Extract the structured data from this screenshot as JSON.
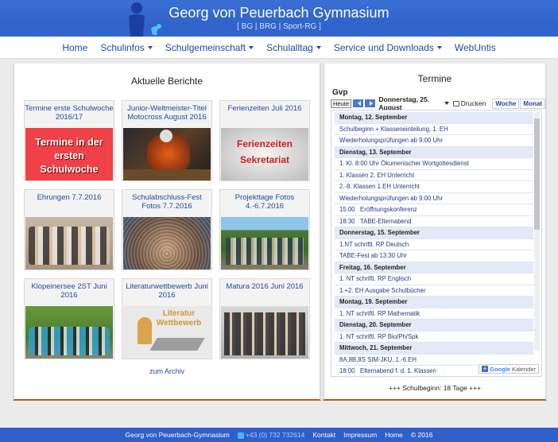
{
  "header": {
    "title": "Georg von Peuerbach Gymnasium",
    "subtitle": "[ BG | BRG | Sport-RG ]"
  },
  "nav": {
    "items": [
      {
        "label": "Home",
        "dropdown": false
      },
      {
        "label": "Schulinfos",
        "dropdown": true
      },
      {
        "label": "Schulgemeinschaft",
        "dropdown": true
      },
      {
        "label": "Schulalltag",
        "dropdown": true
      },
      {
        "label": "Service und Downloads",
        "dropdown": true
      },
      {
        "label": "WebUntis",
        "dropdown": false
      }
    ]
  },
  "reports": {
    "title": "Aktuelle Berichte",
    "cards": [
      {
        "title": "Termine erste Schulwoche 2016/17",
        "image_text": "Termine in der ersten Schulwoche"
      },
      {
        "title": "Junior-Weltmeister-Titel Motocross August 2016"
      },
      {
        "title": "Ferienzeiten Juli 2016",
        "image_text": "Ferienzeiten Sekretariat"
      },
      {
        "title": "Ehrungen 7.7.2016"
      },
      {
        "title": "Schulabschluss-Fest Fotos 7.7.2016"
      },
      {
        "title": "Projekttage Fotos 4.-6.7.2016"
      },
      {
        "title": "Klopeinersee 2ST Juni 2016"
      },
      {
        "title": "Literaturwettbewerb Juni 2016",
        "image_text": "Literatur Wettbewerb"
      },
      {
        "title": "Matura 2016 Juni 2016"
      }
    ],
    "archive_link": "zum Archiv"
  },
  "calendar": {
    "title": "Termine",
    "name": "Gvp",
    "today_button": "Heute",
    "date_label": "Donnerstag, 25. August",
    "print_label": "Drucken",
    "tabs": [
      "Woche",
      "Monat"
    ],
    "rows": [
      {
        "type": "day",
        "text": "Montag, 12. September"
      },
      {
        "type": "event",
        "time": "",
        "text": "Schulbeginn + Klasseneinteilung, 1. EH"
      },
      {
        "type": "event",
        "time": "",
        "text": "Wiederholungsprüfungen ab 9:00 Uhr"
      },
      {
        "type": "day",
        "text": "Dienstag, 13. September"
      },
      {
        "type": "event",
        "time": "",
        "text": "1. Kl. 8:00 Uhr Ökumenischer Wortgottesdienst"
      },
      {
        "type": "event",
        "time": "",
        "text": "1. Klassen 2. EH Unterricht"
      },
      {
        "type": "event",
        "time": "",
        "text": "2.-8. Klassen 1.EH Unterricht"
      },
      {
        "type": "event",
        "time": "",
        "text": "Wiederholungsprüfungen ab 9:00 Uhr"
      },
      {
        "type": "event",
        "time": "15:00",
        "text": "Eröffnungskonferenz"
      },
      {
        "type": "event",
        "time": "18:30",
        "text": "TABE-Elternabend"
      },
      {
        "type": "day",
        "text": "Donnerstag, 15. September"
      },
      {
        "type": "event",
        "time": "",
        "text": "1.NT schriftl. RP Deutsch"
      },
      {
        "type": "event",
        "time": "",
        "text": "TABE-Fest ab 13:30 Uhr"
      },
      {
        "type": "day",
        "text": "Freitag, 16. September"
      },
      {
        "type": "event",
        "time": "",
        "text": "1. NT schriftl. RP Englisch"
      },
      {
        "type": "event",
        "time": "",
        "text": "1.+2. EH Ausgabe Schulbücher"
      },
      {
        "type": "day",
        "text": "Montag, 19. September"
      },
      {
        "type": "event",
        "time": "",
        "text": "1. NT schriftl. RP Mathematik"
      },
      {
        "type": "day",
        "text": "Dienstag, 20. September"
      },
      {
        "type": "event",
        "time": "",
        "text": "1. NT schriftl. RP Bio/Ph/Spk"
      },
      {
        "type": "day",
        "text": "Mittwoch, 21. September"
      },
      {
        "type": "event",
        "time": "",
        "text": "8A,8B,8S SIM-JKU, 1.-6.EH"
      },
      {
        "type": "event",
        "time": "18:00",
        "text": "Elternabend f. d. 1. Klassen"
      }
    ],
    "gcal_google": "Google",
    "gcal_kalender": "Kalender",
    "countdown": "+++ Schulbeginn: 18 Tage +++"
  },
  "footer": {
    "name": "Georg von Peuerbach-Gymnasium",
    "phone": "+43 (0) 732 732614",
    "links": [
      "Kontakt",
      "Impressum",
      "Home"
    ],
    "copyright": "© 2016"
  }
}
